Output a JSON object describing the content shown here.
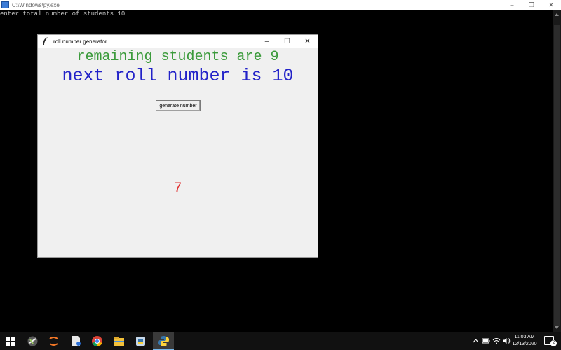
{
  "console": {
    "title": "C:\\Windows\\py.exe",
    "output": "enter total number of students 10"
  },
  "tk_window": {
    "title": "roll number generator",
    "remaining_text": "remaining students are 9",
    "next_text": "next roll number is 10",
    "button_label": "generate number",
    "result_value": "7",
    "colors": {
      "remaining": "#3a9a3a",
      "next": "#2222c8",
      "result": "#e03030"
    }
  },
  "window_controls": {
    "minimize": "–",
    "maximize": "☐",
    "restore": "❐",
    "close": "✕"
  },
  "taskbar": {
    "apps": [
      "start-icon",
      "sublime-icon",
      "jupyter-icon",
      "file-icon",
      "chrome-icon",
      "file-explorer-icon",
      "python-idle-icon",
      "python-icon"
    ],
    "time": "11:03 AM",
    "date": "12/13/2020",
    "notification_count": "2"
  }
}
